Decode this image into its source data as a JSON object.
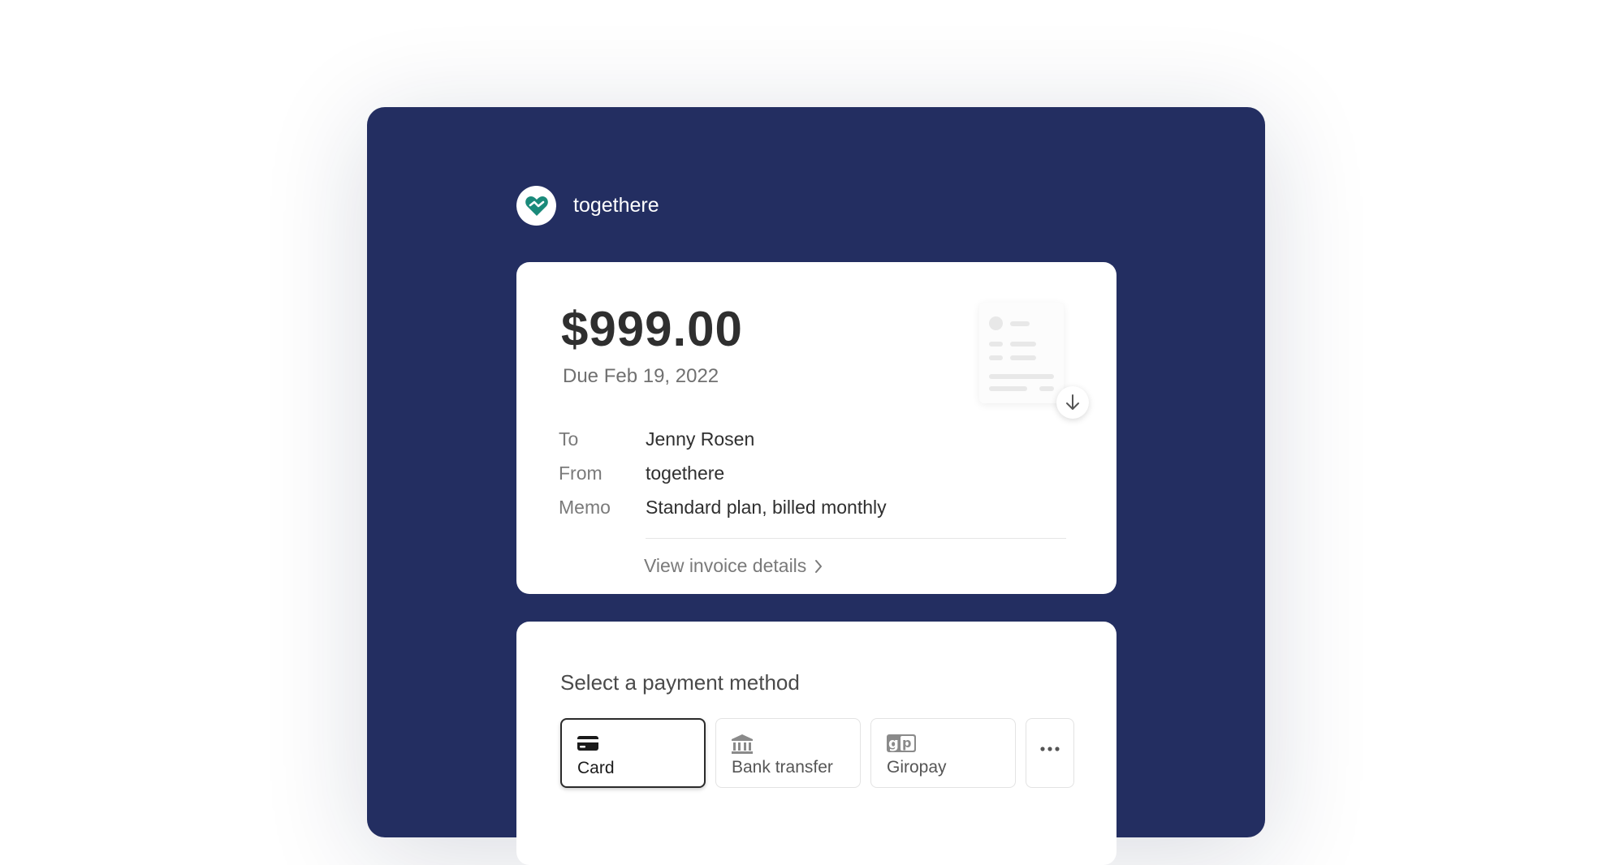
{
  "brand": {
    "name": "togethere",
    "accent_color": "#1a8a7a",
    "background_color": "#232e61"
  },
  "invoice": {
    "amount": "$999.00",
    "due": "Due Feb 19, 2022",
    "details": [
      {
        "label": "To",
        "value": "Jenny Rosen"
      },
      {
        "label": "From",
        "value": "togethere"
      },
      {
        "label": "Memo",
        "value": "Standard plan, billed monthly"
      }
    ],
    "view_details_label": "View invoice details",
    "download_icon": "download-icon",
    "document_icon": "invoice-document-icon"
  },
  "payment": {
    "title": "Select a payment method",
    "methods": [
      {
        "label": "Card",
        "icon": "credit-card-icon",
        "selected": true
      },
      {
        "label": "Bank transfer",
        "icon": "bank-icon",
        "selected": false
      },
      {
        "label": "Giropay",
        "icon": "giropay-icon",
        "selected": false
      }
    ],
    "more_icon": "more-icon"
  }
}
